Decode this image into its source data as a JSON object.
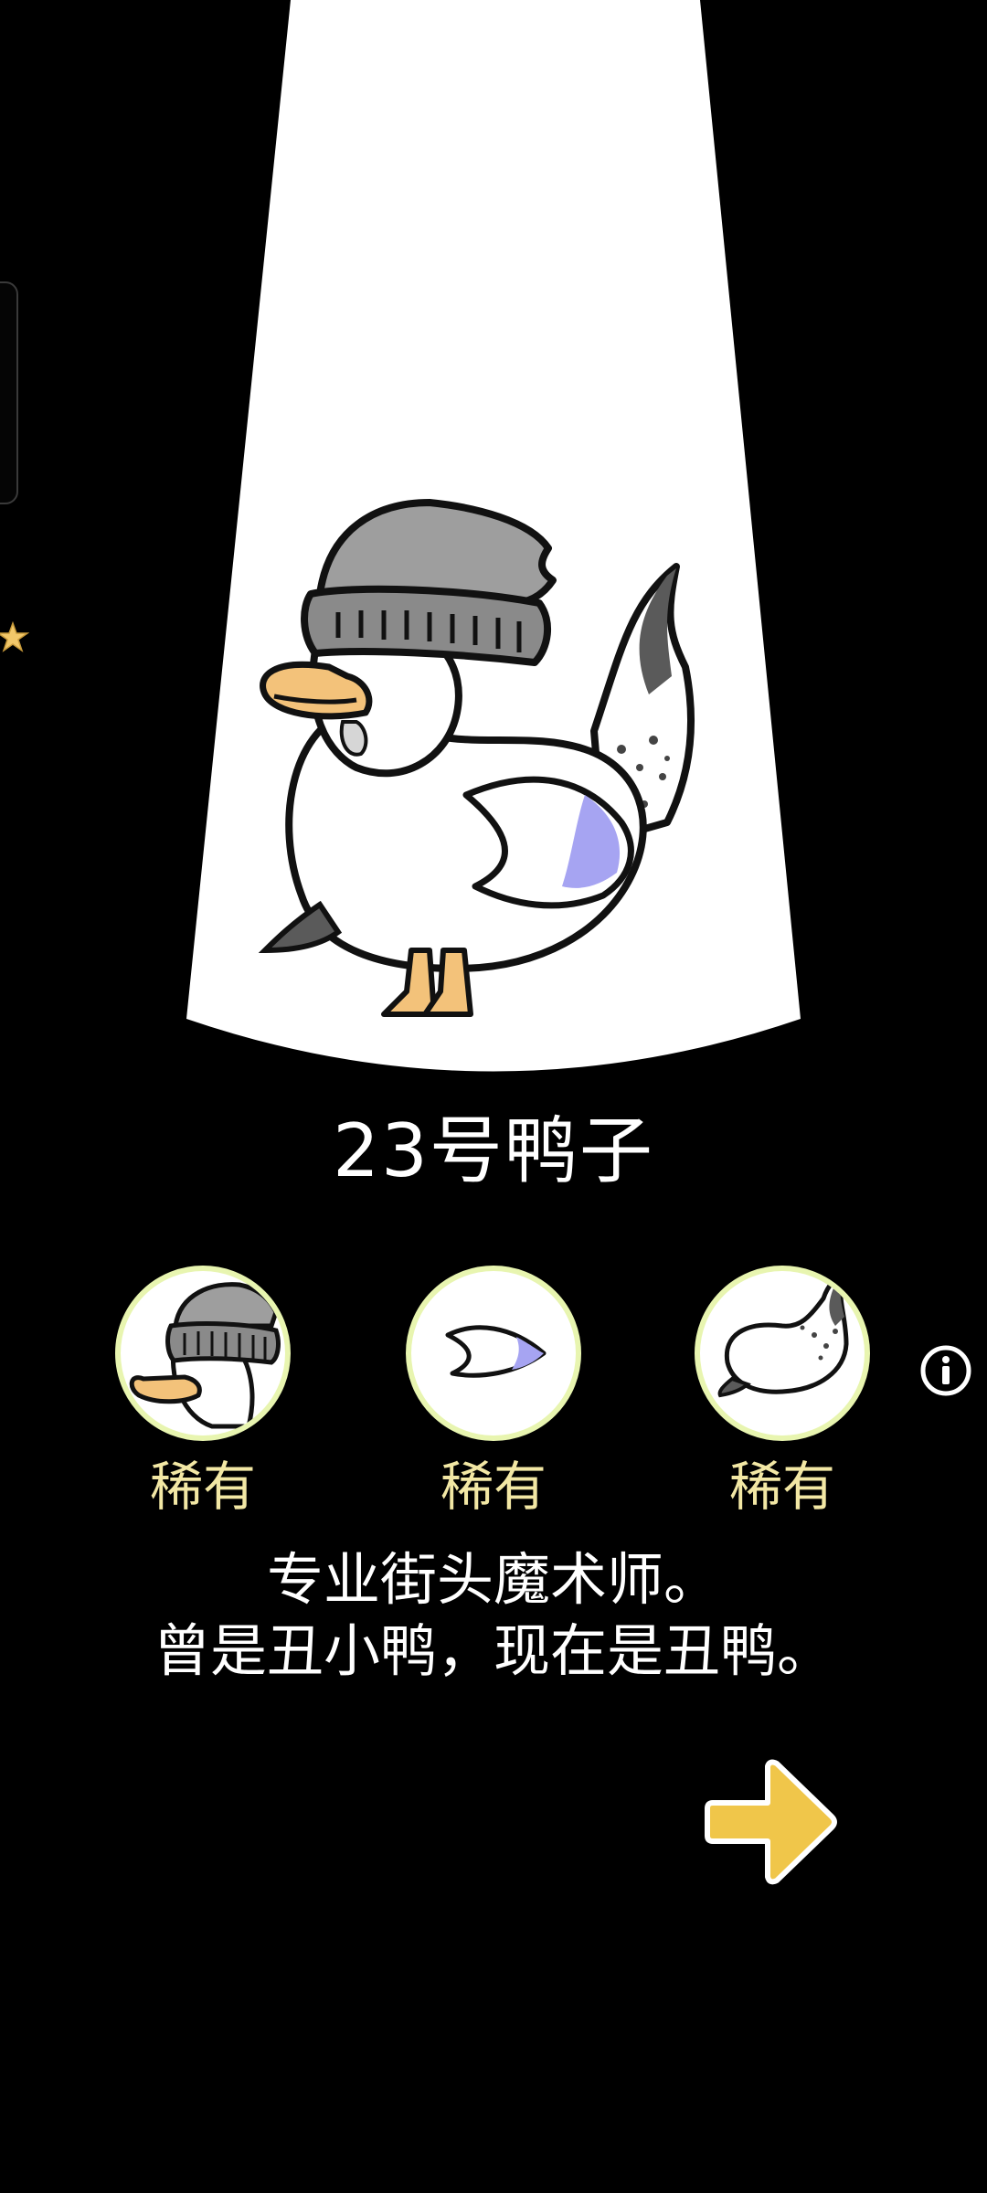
{
  "duck": {
    "name": "23号鸭子",
    "description_line1": "专业街头魔术师。",
    "description_line2": "曾是丑小鸭，现在是丑鸭。"
  },
  "parts": [
    {
      "id": "head",
      "rarity": "稀有",
      "icon": "beanie-head-icon"
    },
    {
      "id": "wing",
      "rarity": "稀有",
      "icon": "wing-icon"
    },
    {
      "id": "body",
      "rarity": "稀有",
      "icon": "body-tail-icon"
    }
  ],
  "icons": {
    "info": "info-icon",
    "next": "arrow-right-icon",
    "side": "star-icon"
  },
  "colors": {
    "background": "#000000",
    "spotlight": "#ffffff",
    "rarity_text": "#f2e7a4",
    "part_ring": "#e8f5b0",
    "arrow": "#f0c64a",
    "accent_blue": "#a6a4f2",
    "beak": "#f3c27a"
  }
}
